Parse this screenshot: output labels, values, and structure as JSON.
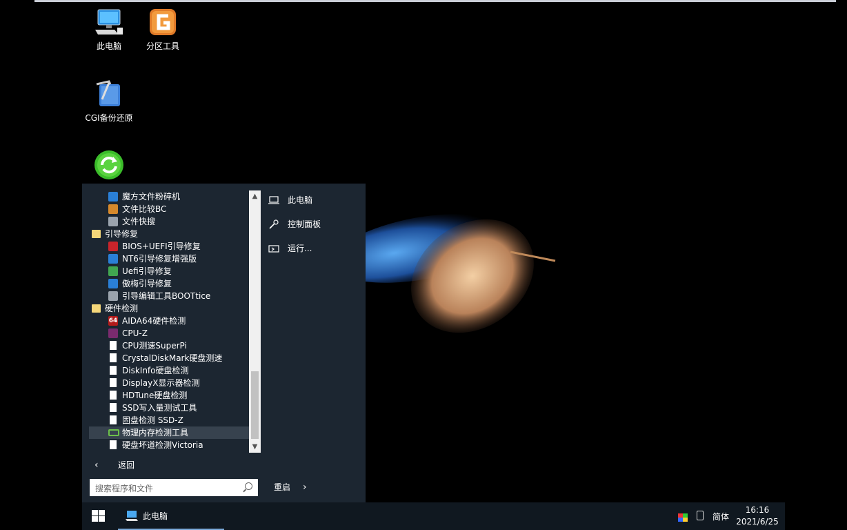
{
  "desktop": {
    "icons": [
      {
        "label": "此电脑",
        "icon": "computer-icon"
      },
      {
        "label": "分区工具",
        "icon": "partition-tool-icon"
      },
      {
        "label": "CGI备份还原",
        "icon": "backup-restore-icon"
      },
      {
        "label": "",
        "icon": "green-refresh-icon"
      }
    ]
  },
  "start_menu": {
    "apps": [
      {
        "label": "魔方文件粉碎机",
        "type": "child",
        "icon": "file-shredder-icon"
      },
      {
        "label": "文件比较BC",
        "type": "child",
        "icon": "compare-icon"
      },
      {
        "label": "文件快搜",
        "type": "child",
        "icon": "search-file-icon"
      },
      {
        "label": "引导修复",
        "type": "folder",
        "icon": "folder-icon"
      },
      {
        "label": "BIOS+UEFI引导修复",
        "type": "child",
        "icon": "bios-icon"
      },
      {
        "label": "NT6引导修复增强版",
        "type": "child",
        "icon": "wrench-icon"
      },
      {
        "label": "Uefi引导修复",
        "type": "child",
        "icon": "uefi-icon"
      },
      {
        "label": "傲梅引导修复",
        "type": "child",
        "icon": "aomei-icon"
      },
      {
        "label": "引导编辑工具BOOTtice",
        "type": "child",
        "icon": "bootice-icon"
      },
      {
        "label": "硬件检测",
        "type": "folder",
        "icon": "folder-icon"
      },
      {
        "label": "AIDA64硬件检测",
        "type": "child",
        "icon": "aida64-icon"
      },
      {
        "label": "CPU-Z",
        "type": "child",
        "icon": "cpuz-icon"
      },
      {
        "label": "CPU测速SuperPi",
        "type": "child",
        "icon": "document-icon"
      },
      {
        "label": "CrystalDiskMark硬盘测速",
        "type": "child",
        "icon": "document-icon"
      },
      {
        "label": "DiskInfo硬盘检测",
        "type": "child",
        "icon": "document-icon"
      },
      {
        "label": "DisplayX显示器检测",
        "type": "child",
        "icon": "document-icon"
      },
      {
        "label": "HDTune硬盘检测",
        "type": "child",
        "icon": "document-icon"
      },
      {
        "label": "SSD写入量测试工具",
        "type": "child",
        "icon": "document-icon"
      },
      {
        "label": "固盘检测 SSD-Z",
        "type": "child",
        "icon": "document-icon"
      },
      {
        "label": "物理内存检测工具",
        "type": "child",
        "icon": "memory-icon",
        "selected": true
      },
      {
        "label": "硬盘坏道检测Victoria",
        "type": "child",
        "icon": "document-icon"
      }
    ],
    "back_label": "返回",
    "search_placeholder": "搜索程序和文件",
    "right_items": [
      {
        "label": "此电脑",
        "icon": "laptop-icon"
      },
      {
        "label": "控制面板",
        "icon": "wrench-icon"
      },
      {
        "label": "运行...",
        "icon": "run-icon"
      }
    ],
    "restart_label": "重启"
  },
  "taskbar": {
    "active_item": "此电脑",
    "language": "简体",
    "time": "16:16",
    "date": "2021/6/25"
  }
}
